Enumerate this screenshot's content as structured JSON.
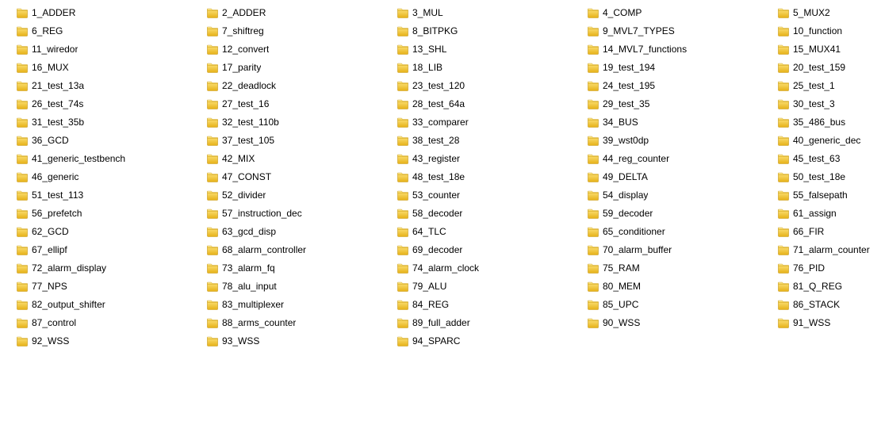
{
  "columns": 5,
  "rows": 19,
  "items": [
    {
      "label": "1_ADDER"
    },
    {
      "label": "2_ADDER"
    },
    {
      "label": "3_MUL"
    },
    {
      "label": "4_COMP"
    },
    {
      "label": "5_MUX2"
    },
    {
      "label": "6_REG"
    },
    {
      "label": "7_shiftreg"
    },
    {
      "label": "8_BITPKG"
    },
    {
      "label": "9_MVL7_TYPES"
    },
    {
      "label": "10_function"
    },
    {
      "label": "11_wiredor"
    },
    {
      "label": "12_convert"
    },
    {
      "label": "13_SHL"
    },
    {
      "label": "14_MVL7_functions"
    },
    {
      "label": "15_MUX41"
    },
    {
      "label": "16_MUX"
    },
    {
      "label": "17_parity"
    },
    {
      "label": "18_LIB"
    },
    {
      "label": "19_test_194"
    },
    {
      "label": "20_test_159"
    },
    {
      "label": "21_test_13a"
    },
    {
      "label": "22_deadlock"
    },
    {
      "label": "23_test_120"
    },
    {
      "label": "24_test_195"
    },
    {
      "label": "25_test_1"
    },
    {
      "label": "26_test_74s"
    },
    {
      "label": "27_test_16"
    },
    {
      "label": "28_test_64a"
    },
    {
      "label": "29_test_35"
    },
    {
      "label": "30_test_3"
    },
    {
      "label": "31_test_35b"
    },
    {
      "label": "32_test_110b"
    },
    {
      "label": "33_comparer"
    },
    {
      "label": "34_BUS"
    },
    {
      "label": "35_486_bus"
    },
    {
      "label": "36_GCD"
    },
    {
      "label": "37_test_105"
    },
    {
      "label": "38_test_28"
    },
    {
      "label": "39_wst0dp"
    },
    {
      "label": "40_generic_dec"
    },
    {
      "label": "41_generic_testbench"
    },
    {
      "label": "42_MIX"
    },
    {
      "label": "43_register"
    },
    {
      "label": "44_reg_counter"
    },
    {
      "label": "45_test_63"
    },
    {
      "label": "46_generic"
    },
    {
      "label": "47_CONST"
    },
    {
      "label": "48_test_18e"
    },
    {
      "label": "49_DELTA"
    },
    {
      "label": "50_test_18e"
    },
    {
      "label": "51_test_113"
    },
    {
      "label": "52_divider"
    },
    {
      "label": "53_counter"
    },
    {
      "label": "54_display"
    },
    {
      "label": "55_falsepath"
    },
    {
      "label": "56_prefetch"
    },
    {
      "label": "57_instruction_dec"
    },
    {
      "label": "58_decoder"
    },
    {
      "label": "59_decoder"
    },
    {
      "label": "61_assign"
    },
    {
      "label": "62_GCD"
    },
    {
      "label": "63_gcd_disp"
    },
    {
      "label": "64_TLC"
    },
    {
      "label": "65_conditioner"
    },
    {
      "label": "66_FIR"
    },
    {
      "label": "67_ellipf"
    },
    {
      "label": "68_alarm_controller"
    },
    {
      "label": "69_decoder"
    },
    {
      "label": "70_alarm_buffer"
    },
    {
      "label": "71_alarm_counter"
    },
    {
      "label": "72_alarm_display"
    },
    {
      "label": "73_alarm_fq"
    },
    {
      "label": "74_alarm_clock"
    },
    {
      "label": "75_RAM"
    },
    {
      "label": "76_PID"
    },
    {
      "label": "77_NPS"
    },
    {
      "label": "78_alu_input"
    },
    {
      "label": "79_ALU"
    },
    {
      "label": "80_MEM"
    },
    {
      "label": "81_Q_REG"
    },
    {
      "label": "82_output_shifter"
    },
    {
      "label": "83_multiplexer"
    },
    {
      "label": "84_REG"
    },
    {
      "label": "85_UPC"
    },
    {
      "label": "86_STACK"
    },
    {
      "label": "87_control"
    },
    {
      "label": "88_arms_counter"
    },
    {
      "label": "89_full_adder"
    },
    {
      "label": "90_WSS"
    },
    {
      "label": "91_WSS"
    },
    {
      "label": "92_WSS"
    },
    {
      "label": "93_WSS"
    },
    {
      "label": "94_SPARC"
    }
  ]
}
